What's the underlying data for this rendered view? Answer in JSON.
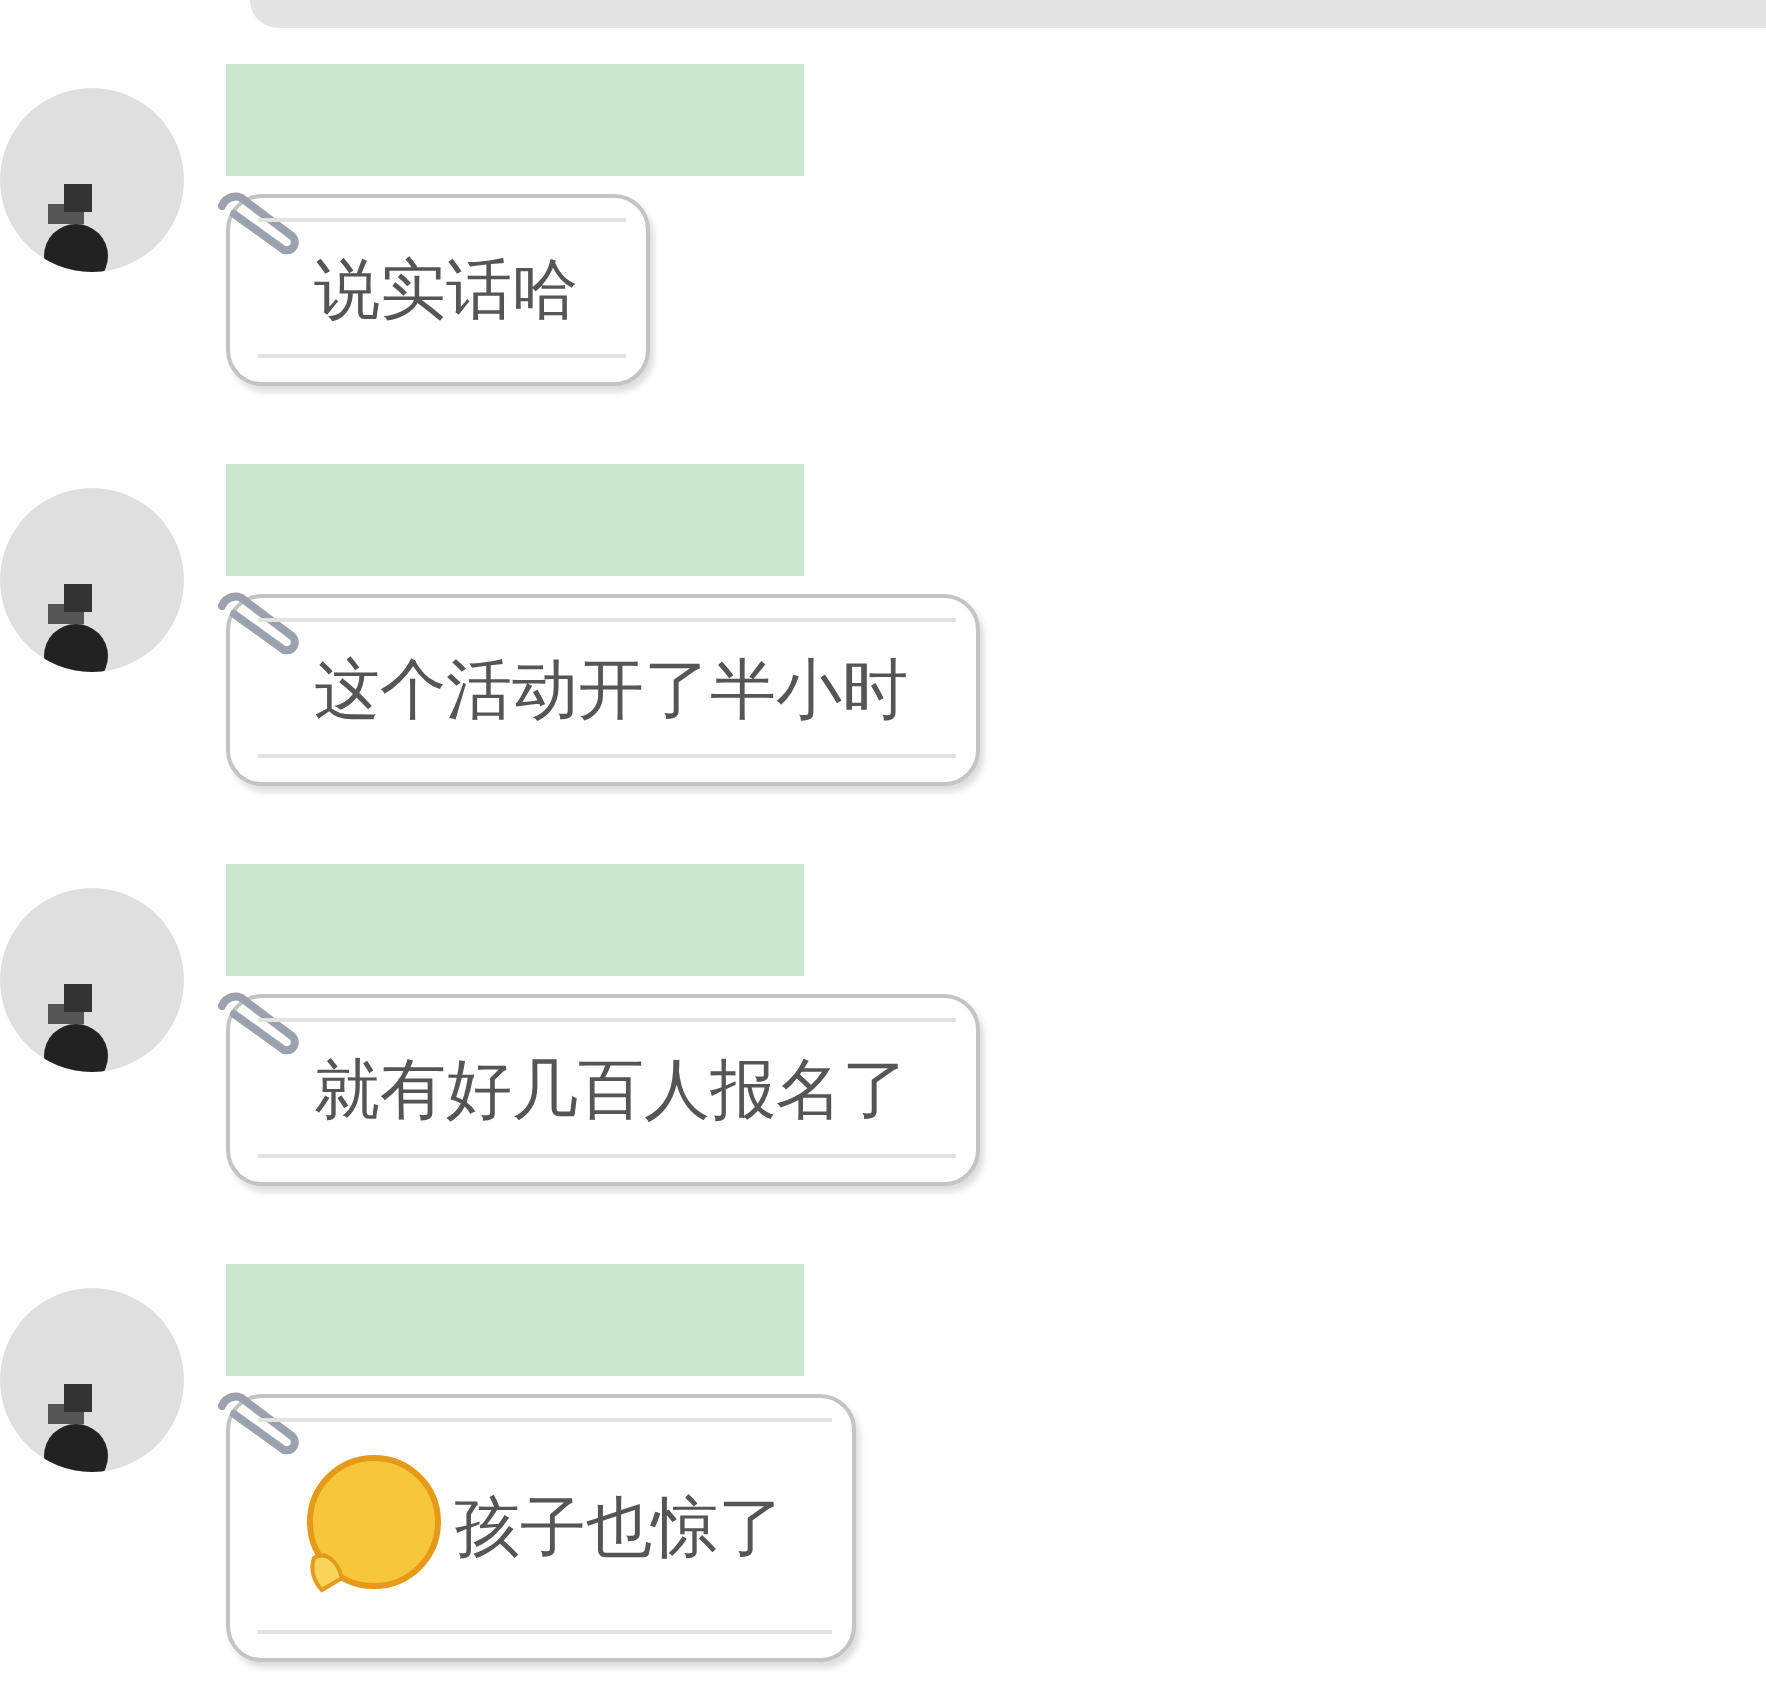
{
  "messages": [
    {
      "kind": "text",
      "text": "说实话哈"
    },
    {
      "kind": "text",
      "text": "这个活动开了半小时"
    },
    {
      "kind": "text",
      "text": "就有好几百人报名了"
    },
    {
      "kind": "emoji_text",
      "text": "孩子也惊了"
    }
  ]
}
